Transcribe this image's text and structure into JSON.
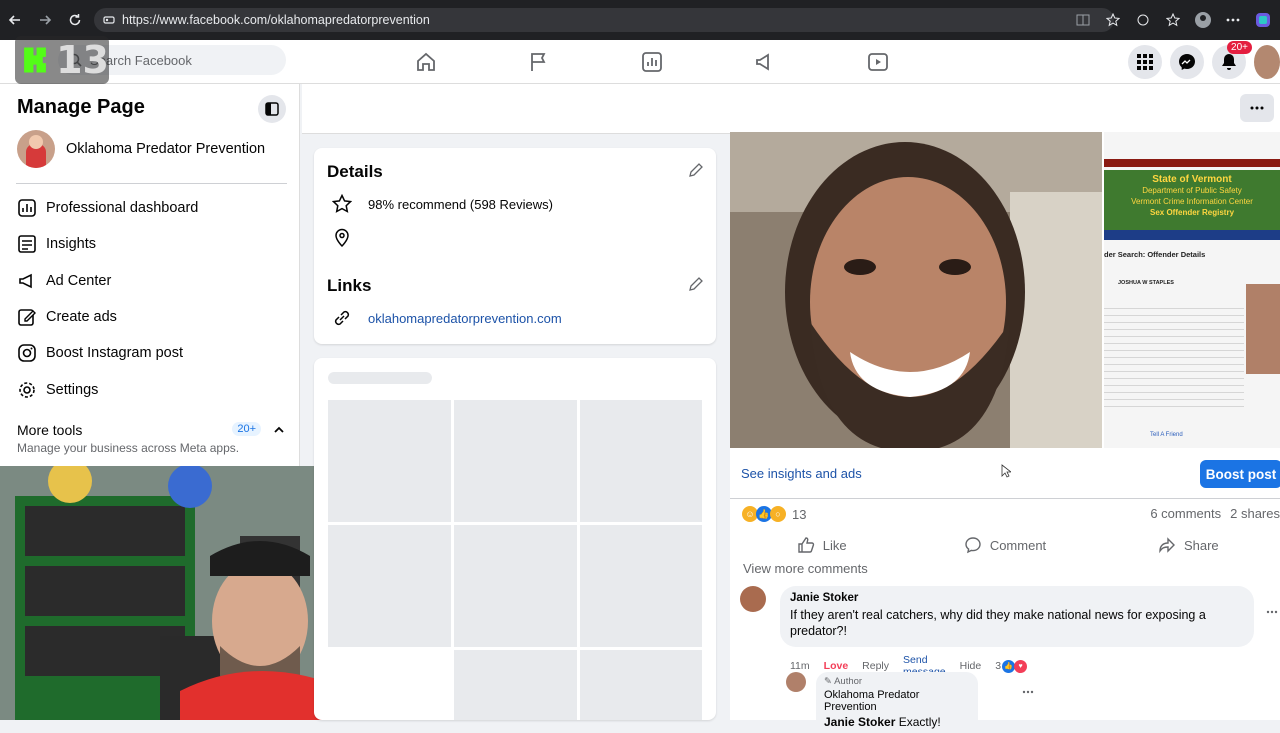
{
  "browser": {
    "url": "https://www.facebook.com/oklahomapredatorprevention"
  },
  "topnav": {
    "search_placeholder": "Search Facebook",
    "overlay_number": "13",
    "notification_badge": "20+"
  },
  "sidebar": {
    "title": "Manage Page",
    "page_name": "Oklahoma Predator Prevention",
    "items": [
      {
        "label": "Professional dashboard",
        "icon": "dashboard-icon"
      },
      {
        "label": "Insights",
        "icon": "insights-icon"
      },
      {
        "label": "Ad Center",
        "icon": "megaphone-icon"
      },
      {
        "label": "Create ads",
        "icon": "pencil-square-icon"
      },
      {
        "label": "Boost Instagram post",
        "icon": "instagram-icon"
      },
      {
        "label": "Settings",
        "icon": "gear-icon"
      }
    ],
    "more_tools": {
      "title": "More tools",
      "subtitle": "Manage your business across Meta apps.",
      "count": "20+"
    }
  },
  "details": {
    "title": "Details",
    "recommend": "98% recommend (598 Reviews)",
    "links_title": "Links",
    "website": "oklahomapredatorprevention.com"
  },
  "post": {
    "see_insights": "See insights and ads",
    "boost_label": "Boost post",
    "reaction_count": "13",
    "comments_count": "6 comments",
    "shares_count": "2 shares",
    "like_label": "Like",
    "comment_label": "Comment",
    "share_label": "Share",
    "view_more": "View more comments",
    "comment": {
      "author": "Janie Stoker",
      "text": "If they aren't real catchers, why did they make national news for exposing a predator?!",
      "time": "11m",
      "love": "Love",
      "reply": "Reply",
      "send_message": "Send message",
      "hide": "Hide",
      "reactions": "3"
    },
    "reply": {
      "author_tag": "Author",
      "page_name": "Oklahoma Predator Prevention",
      "mention": "Janie Stoker",
      "text": "Exactly!"
    },
    "registry": {
      "line1": "State of Vermont",
      "line2": "Department of Public Safety",
      "line3": "Vermont Crime Information Center",
      "line4": "Sex Offender Registry",
      "heading": "der Search: Offender Details",
      "name": "JOSHUA W STAPLES",
      "link": "Tell A Friend"
    }
  },
  "colors": {
    "accent": "#1b74e4",
    "link": "#1d53a8",
    "love": "#f33e58"
  }
}
